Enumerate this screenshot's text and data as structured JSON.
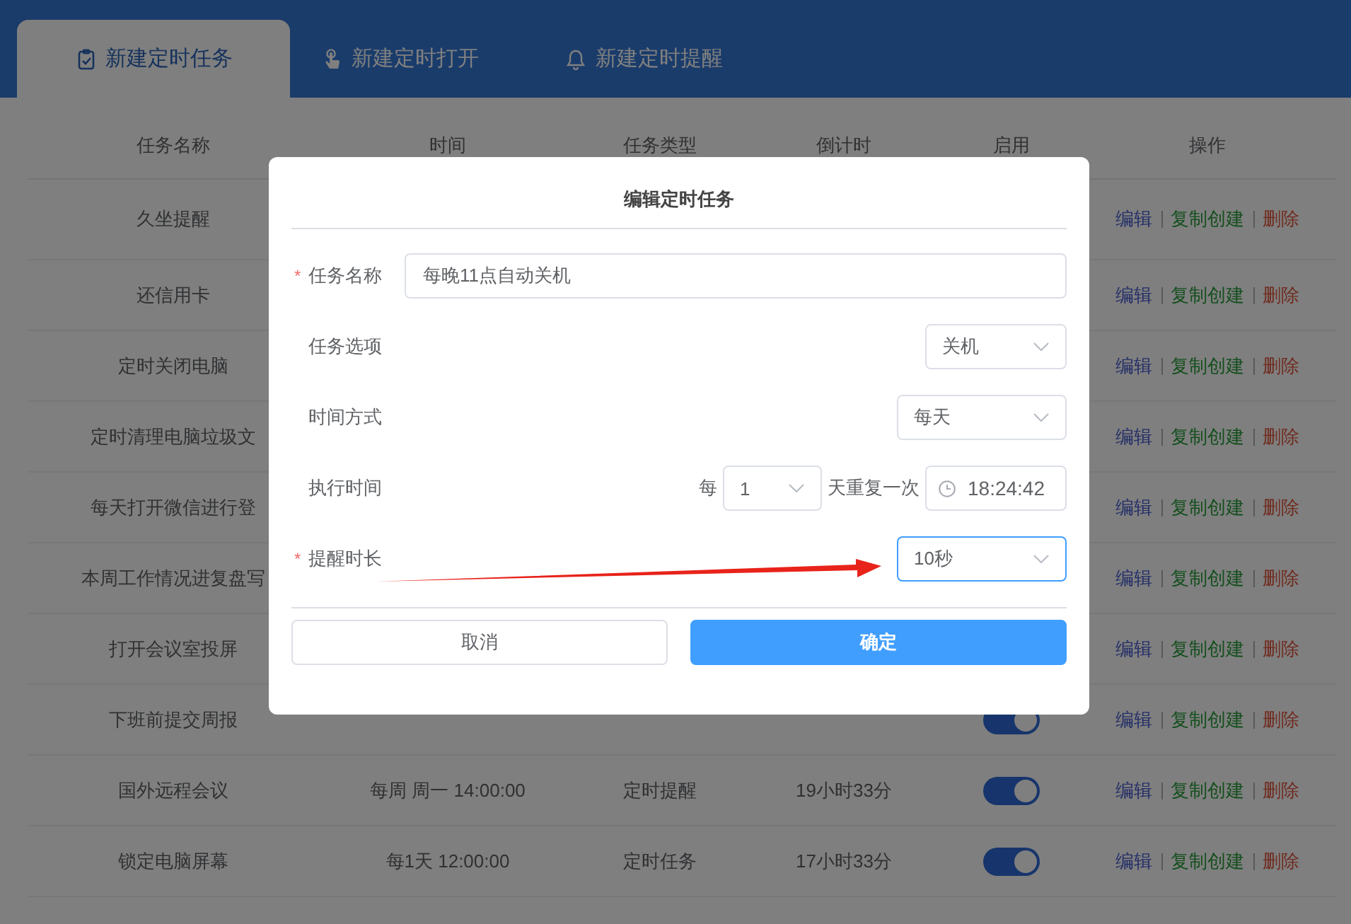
{
  "tabs": [
    {
      "label": "新建定时任务",
      "selected": true
    },
    {
      "label": "新建定时打开",
      "selected": false
    },
    {
      "label": "新建定时提醒",
      "selected": false
    }
  ],
  "table": {
    "columns": [
      "任务名称",
      "时间",
      "任务类型",
      "倒计时",
      "启用",
      "操作"
    ],
    "rows": [
      {
        "name": "久坐提醒",
        "actions": [
          {
            "label": "编辑",
            "kind": "edit"
          },
          {
            "label": "复制创建",
            "kind": "copy"
          },
          {
            "label": "删除",
            "kind": "delete"
          }
        ]
      },
      {
        "name": "还信用卡",
        "actions": [
          {
            "label": "编辑",
            "kind": "edit"
          },
          {
            "label": "复制创建",
            "kind": "copy"
          },
          {
            "label": "删除",
            "kind": "delete"
          }
        ]
      },
      {
        "name": "定时关闭电脑",
        "actions": [
          {
            "label": "编辑",
            "kind": "edit"
          },
          {
            "label": "复制创建",
            "kind": "copy"
          },
          {
            "label": "删除",
            "kind": "delete"
          }
        ]
      },
      {
        "name": "定时清理电脑垃圾文",
        "actions": [
          {
            "label": "编辑",
            "kind": "edit"
          },
          {
            "label": "复制创建",
            "kind": "copy"
          },
          {
            "label": "删除",
            "kind": "delete"
          }
        ]
      },
      {
        "name": "每天打开微信进行登",
        "actions": [
          {
            "label": "编辑",
            "kind": "edit"
          },
          {
            "label": "复制创建",
            "kind": "copy"
          },
          {
            "label": "删除",
            "kind": "delete"
          }
        ]
      },
      {
        "name": "本周工作情况进复盘写",
        "actions": [
          {
            "label": "编辑",
            "kind": "edit"
          },
          {
            "label": "复制创建",
            "kind": "copy"
          },
          {
            "label": "删除",
            "kind": "delete"
          }
        ]
      },
      {
        "name": "打开会议室投屏",
        "actions": [
          {
            "label": "编辑",
            "kind": "edit"
          },
          {
            "label": "复制创建",
            "kind": "copy"
          },
          {
            "label": "删除",
            "kind": "delete"
          }
        ]
      },
      {
        "name": "下班前提交周报",
        "enabled": true,
        "actions": [
          {
            "label": "编辑",
            "kind": "edit"
          },
          {
            "label": "复制创建",
            "kind": "copy"
          },
          {
            "label": "删除",
            "kind": "delete"
          }
        ]
      },
      {
        "name": "国外远程会议",
        "time": "每周 周一 14:00:00",
        "type": "定时提醒",
        "countdown": "19小时33分",
        "enabled": true,
        "actions": [
          {
            "label": "编辑",
            "kind": "edit"
          },
          {
            "label": "复制创建",
            "kind": "copy"
          },
          {
            "label": "删除",
            "kind": "delete"
          }
        ]
      },
      {
        "name": "锁定电脑屏幕",
        "time": "每1天 12:00:00",
        "type": "定时任务",
        "countdown": "17小时33分",
        "enabled": true,
        "actions": [
          {
            "label": "编辑",
            "kind": "edit"
          },
          {
            "label": "复制创建",
            "kind": "copy"
          },
          {
            "label": "删除",
            "kind": "delete"
          }
        ]
      }
    ]
  },
  "dialog": {
    "title": "编辑定时任务",
    "fields": [
      {
        "kind": "text",
        "required_mark": "*",
        "label": "任务名称",
        "value": "每晚11点自动关机"
      },
      {
        "kind": "select",
        "label": "任务选项",
        "value": "关机",
        "focused": false
      },
      {
        "kind": "select",
        "label": "时间方式",
        "value": "每天",
        "focused": false
      },
      {
        "kind": "schedule",
        "label": "执行时间",
        "prefix": "每",
        "count": "1",
        "suffix": "天重复一次",
        "time": "18:24:42"
      },
      {
        "kind": "select",
        "required_mark": "*",
        "label": "提醒时长",
        "value": "10秒",
        "focused": true
      }
    ],
    "buttons": [
      {
        "label": "取消",
        "kind": "secondary"
      },
      {
        "label": "确定",
        "kind": "primary"
      }
    ]
  }
}
